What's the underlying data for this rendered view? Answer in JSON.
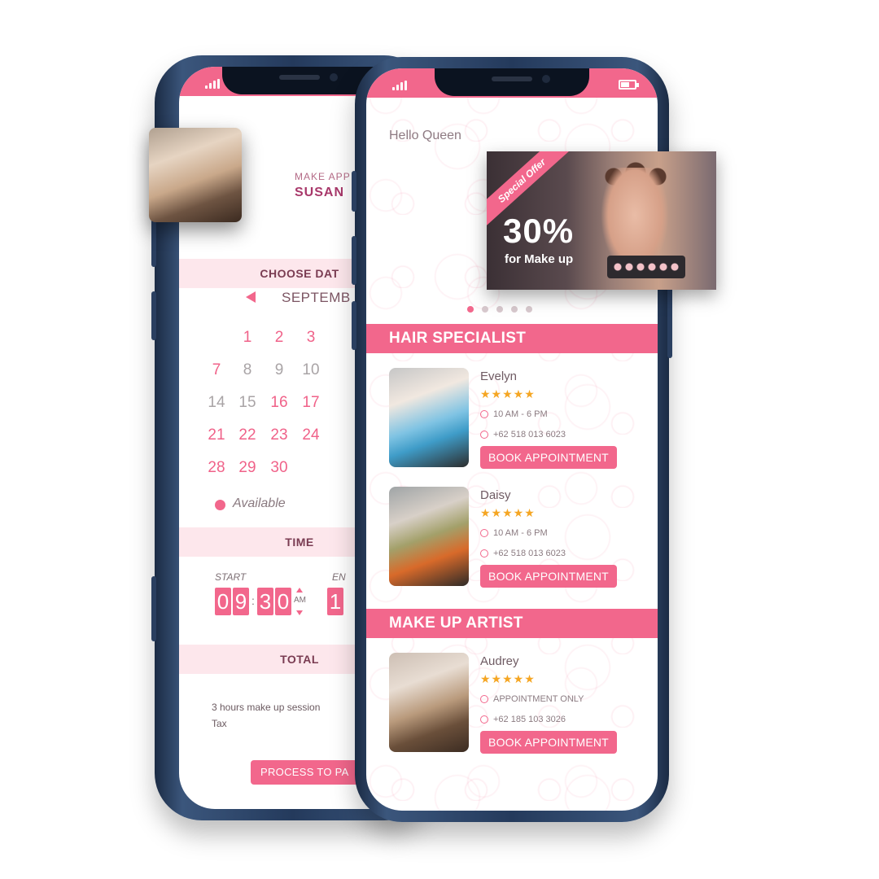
{
  "back_screen": {
    "appointment_label": "MAKE APP",
    "specialist_name": "SUSAN",
    "choose_date_label": "CHOOSE DAT",
    "month_label": "SEPTEMB",
    "calendar_days": [
      {
        "label": "1",
        "status": "available"
      },
      {
        "label": "2",
        "status": "available"
      },
      {
        "label": "3",
        "status": "available"
      },
      {
        "label": "7",
        "status": "available"
      },
      {
        "label": "8",
        "status": "unavailable"
      },
      {
        "label": "9",
        "status": "unavailable"
      },
      {
        "label": "10",
        "status": "unavailable"
      },
      {
        "label": "14",
        "status": "unavailable"
      },
      {
        "label": "15",
        "status": "unavailable"
      },
      {
        "label": "16",
        "status": "available"
      },
      {
        "label": "17",
        "status": "available"
      },
      {
        "label": "21",
        "status": "available"
      },
      {
        "label": "22",
        "status": "available"
      },
      {
        "label": "23",
        "status": "available"
      },
      {
        "label": "24",
        "status": "available"
      },
      {
        "label": "28",
        "status": "available"
      },
      {
        "label": "29",
        "status": "available"
      },
      {
        "label": "30",
        "status": "available"
      }
    ],
    "legend_label": "Available",
    "time_label": "TIME",
    "start_label": "START",
    "end_label": "EN",
    "start_time": {
      "h1": "0",
      "h2": "9",
      "m1": "3",
      "m2": "0",
      "meridiem": "AM"
    },
    "end_digit": "1",
    "total_label": "TOTAL",
    "line_items": [
      "3 hours make up session",
      "Tax"
    ],
    "pay_button": "PROCESS TO PA"
  },
  "front_screen": {
    "greeting": "Hello Queen",
    "promo": {
      "ribbon": "Special Offer",
      "discount": "30%",
      "subtitle": "for Make up"
    },
    "carousel": {
      "count": 5,
      "active": 0
    },
    "sections": [
      {
        "title": "HAIR SPECIALIST",
        "specialists": [
          {
            "name": "Evelyn",
            "stars": "★★★★★",
            "hours": "10 AM - 6 PM",
            "phone": "+62 518 013 6023",
            "button": "BOOK APPOINTMENT"
          },
          {
            "name": "Daisy",
            "stars": "★★★★★",
            "hours": "10 AM - 6 PM",
            "phone": "+62 518 013 6023",
            "button": "BOOK APPOINTMENT"
          }
        ]
      },
      {
        "title": "MAKE UP ARTIST",
        "specialists": [
          {
            "name": "Audrey",
            "stars": "★★★★★",
            "hours": "APPOINTMENT ONLY",
            "phone": "+62 185 103 3026",
            "button": "BOOK APPOINTMENT"
          }
        ]
      }
    ]
  },
  "colors": {
    "accent": "#f2678c",
    "accent_light": "#fde7ec",
    "frame": "#243a5c"
  }
}
